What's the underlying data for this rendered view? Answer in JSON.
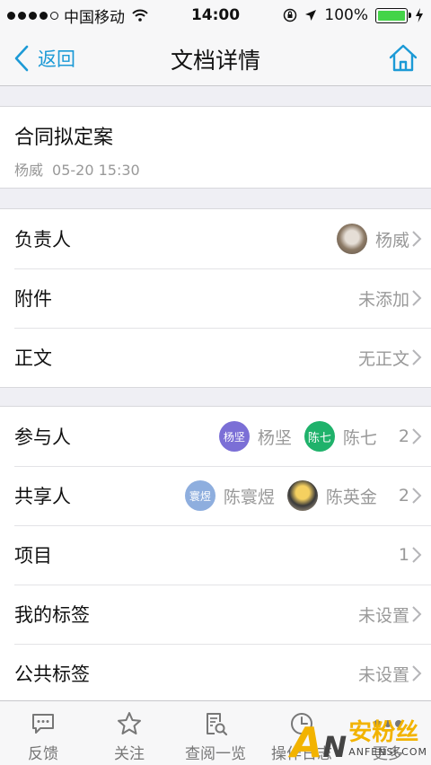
{
  "status_bar": {
    "carrier": "中国移动",
    "time": "14:00",
    "battery": "100%"
  },
  "nav": {
    "back_label": "返回",
    "title": "文档详情"
  },
  "document": {
    "title": "合同拟定案",
    "author": "杨威",
    "datetime": "05-20 15:30"
  },
  "section1": {
    "owner": {
      "label": "负责人",
      "value": "杨威"
    },
    "attachment": {
      "label": "附件",
      "value": "未添加"
    },
    "body": {
      "label": "正文",
      "value": "无正文"
    }
  },
  "section2": {
    "participants": {
      "label": "参与人",
      "people": [
        {
          "avatar_text": "杨坚",
          "name": "杨坚"
        },
        {
          "avatar_text": "陈七",
          "name": "陈七"
        }
      ],
      "count": "2"
    },
    "sharers": {
      "label": "共享人",
      "people": [
        {
          "avatar_text": "寰煜",
          "name": "陈寰煜"
        },
        {
          "avatar_text": "",
          "name": "陈英金"
        }
      ],
      "count": "2"
    },
    "project": {
      "label": "项目",
      "count": "1"
    },
    "my_tags": {
      "label": "我的标签",
      "value": "未设置"
    },
    "public_tags": {
      "label": "公共标签",
      "value": "未设置"
    }
  },
  "tabs": [
    {
      "label": "反馈",
      "icon": "comment-icon"
    },
    {
      "label": "关注",
      "icon": "star-icon"
    },
    {
      "label": "查阅一览",
      "icon": "document-search-icon"
    },
    {
      "label": "操作日志",
      "icon": "clock-icon"
    },
    {
      "label": "更多",
      "icon": "more-dots-icon"
    }
  ],
  "watermark": {
    "logo": "AN",
    "cn": "安粉丝",
    "en": "ANFENSI.COM"
  },
  "colors": {
    "accent": "#1c9ad6",
    "battery": "#44d448",
    "background": "#efeff4"
  }
}
